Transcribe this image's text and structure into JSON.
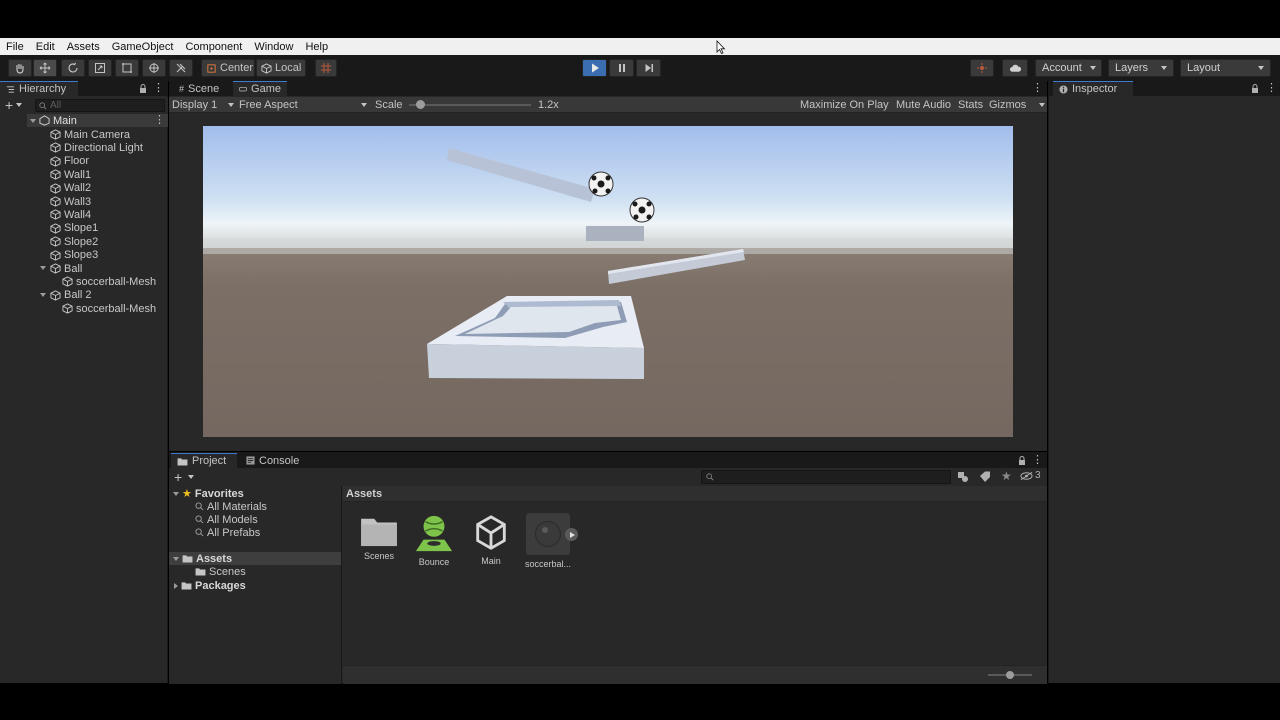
{
  "menu": [
    "File",
    "Edit",
    "Assets",
    "GameObject",
    "Component",
    "Window",
    "Help"
  ],
  "toolbar": {
    "pivot_center": "Center",
    "pivot_local": "Local",
    "account": "Account",
    "layers": "Layers",
    "layout": "Layout"
  },
  "hierarchy": {
    "tab": "Hierarchy",
    "search_placeholder": "All",
    "scene": "Main",
    "items": [
      {
        "label": "Main Camera",
        "depth": 1
      },
      {
        "label": "Directional Light",
        "depth": 1
      },
      {
        "label": "Floor",
        "depth": 1
      },
      {
        "label": "Wall1",
        "depth": 1
      },
      {
        "label": "Wall2",
        "depth": 1
      },
      {
        "label": "Wall3",
        "depth": 1
      },
      {
        "label": "Wall4",
        "depth": 1
      },
      {
        "label": "Slope1",
        "depth": 1
      },
      {
        "label": "Slope2",
        "depth": 1
      },
      {
        "label": "Slope3",
        "depth": 1
      },
      {
        "label": "Ball",
        "depth": 1,
        "expanded": true
      },
      {
        "label": "soccerball-Mesh",
        "depth": 2
      },
      {
        "label": "Ball 2",
        "depth": 1,
        "expanded": true
      },
      {
        "label": "soccerball-Mesh",
        "depth": 2
      }
    ]
  },
  "game": {
    "tabs": {
      "scene": "Scene",
      "game": "Game"
    },
    "display": "Display 1",
    "aspect": "Free Aspect",
    "scale_label": "Scale",
    "scale_value": "1.2x",
    "maximize": "Maximize On Play",
    "mute": "Mute Audio",
    "stats": "Stats",
    "gizmos": "Gizmos"
  },
  "project": {
    "tabs": {
      "project": "Project",
      "console": "Console"
    },
    "favorites": "Favorites",
    "fav_items": [
      "All Materials",
      "All Models",
      "All Prefabs"
    ],
    "assets_root": "Assets",
    "scenes_folder": "Scenes",
    "packages": "Packages",
    "breadcrumb": "Assets",
    "hidden_count": "3",
    "assets": [
      {
        "label": "Scenes",
        "icon": "folder-icon"
      },
      {
        "label": "Bounce",
        "icon": "physic-material-icon"
      },
      {
        "label": "Main",
        "icon": "unity-scene-icon"
      },
      {
        "label": "soccerbal...",
        "icon": "soccerball-model-icon"
      }
    ]
  },
  "inspector": {
    "tab": "Inspector"
  },
  "colors": {
    "play_active": "#3b6eb0",
    "accent_green": "#7ec34a",
    "panel": "#282828",
    "sky_top": "#a9c4ee",
    "ground": "#7a6e64"
  }
}
